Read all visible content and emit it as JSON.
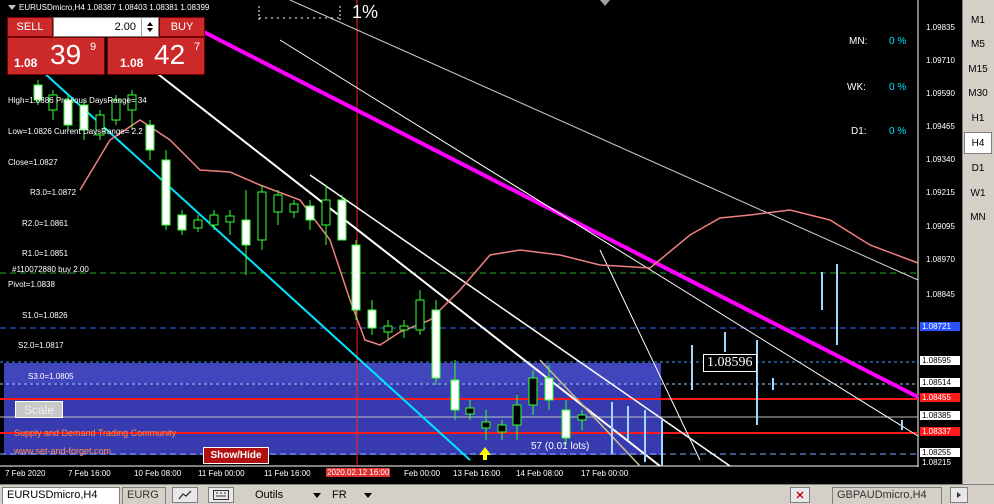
{
  "symbol_title": "EURUSDmicro,H4  1.08387 1.08403 1.08381 1.08399",
  "risk_label": "1%",
  "trade_panel": {
    "sell_label": "SELL",
    "buy_label": "BUY",
    "volume": "2.00",
    "bid_prefix": "1.08",
    "bid_big": "39",
    "bid_sup": "9",
    "ask_prefix": "1.08",
    "ask_big": "42",
    "ask_sup": "7"
  },
  "pivot_info": [
    "High=1.0886 Previous DaysRange= 34",
    "Low=1.0826 Current DaysRange= 2.2",
    "Close=1.0827",
    "R3.0=1.0872",
    "R2.0=1.0861",
    "R1.0=1.0851",
    "Pivot=1.0838",
    "S1.0=1.0826",
    "S2.0=1.0817",
    "S3.0=1.0805"
  ],
  "range_panel": {
    "mn_label": "MN:",
    "mn_value": "0 %",
    "wk_label": "WK:",
    "wk_value": "0 %",
    "d1_label": "D1:",
    "d1_value": "0 %"
  },
  "order_label": "#110072880 buy 2.00",
  "price_box_label": "1.08596",
  "lots_label": "57 (0.01 lots)",
  "scale_button": "Scale",
  "community_text": "Supply and Demand Trading Community",
  "community_url": "www.set-and-forget.com",
  "show_hide_button": "Show/Hide",
  "price_axis": [
    "1.09835",
    "1.09710",
    "1.09590",
    "1.09465",
    "1.09340",
    "1.09215",
    "1.09095",
    "1.08970",
    "1.08845"
  ],
  "price_tags": {
    "t1": "1.08721",
    "t2": "1.08595",
    "t3": "1.08514",
    "t4": "1.08455",
    "t5": "1.08385",
    "t6": "1.08337",
    "t7": "1.08255",
    "t8": "1.08215"
  },
  "time_axis": [
    "7 Feb 2020",
    "7 Feb 16:00",
    "10 Feb 08:00",
    "11 Feb 00:00",
    "11 Feb 16:00",
    "2020.02.12 16:00",
    "Feb 00:00",
    "13 Feb 16:00",
    "14 Feb 08:00",
    "17 Feb 00:00"
  ],
  "timeframes": [
    "M1",
    "M5",
    "M15",
    "M30",
    "H1",
    "H4",
    "D1",
    "W1",
    "MN"
  ],
  "active_timeframe": "H4",
  "tabs": {
    "active": "EURUSDmicro,H4",
    "second": "EURG",
    "right": "GBPAUDmicro,H4"
  },
  "toolbar": {
    "menu1": "Outils",
    "menu2": "FR"
  },
  "colors": {
    "chart_bg": "#000000",
    "zone_blue": "#3b3eb8",
    "magenta_line": "#ff00ff",
    "cyan_line": "#00e5ff",
    "ma_line": "#f08080",
    "red_lines": "#ff1a1a",
    "sell_btn": "#cc2a2a"
  }
}
